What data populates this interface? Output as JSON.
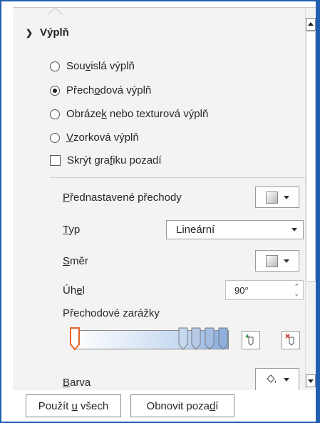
{
  "fill": {
    "section_title": "Výplň",
    "options": [
      {
        "pre": "Sou",
        "key": "v",
        "post": "islá výplň",
        "checked": false
      },
      {
        "pre": "Přech",
        "key": "o",
        "post": "dová výplň",
        "checked": true
      },
      {
        "pre": "Obráze",
        "key": "k",
        "post": " nebo texturová výplň",
        "checked": false
      },
      {
        "pre": "",
        "key": "V",
        "post": "zorková výplň",
        "checked": false
      }
    ],
    "hide_bg": {
      "pre": "Skrýt gra",
      "key": "f",
      "post": "iku pozadí",
      "checked": false
    }
  },
  "gradient": {
    "preset_label": {
      "pre": "",
      "key": "P",
      "post": "řednastavené přechody"
    },
    "type_label": {
      "pre": "",
      "key": "T",
      "post": "yp"
    },
    "type_value": "Lineární",
    "direction_label": {
      "pre": "",
      "key": "S",
      "post": "měr"
    },
    "angle_label": {
      "pre": "Úh",
      "key": "e",
      "post": "l"
    },
    "angle_value": "90°",
    "stops_label": "Přechodové zarážky",
    "color_label": {
      "pre": "",
      "key": "B",
      "post": "arva"
    }
  },
  "footer": {
    "apply_all": {
      "pre": "Použít ",
      "key": "u",
      "post": " všech"
    },
    "reset_bg": {
      "pre": "Obnovit poza",
      "key": "d",
      "post": "í"
    }
  },
  "colors": {
    "frame": "#1f5fb0",
    "pane": "#f3f3f3",
    "stop_selected": "#e2632b",
    "gradient_end": "#7fa7dc"
  }
}
